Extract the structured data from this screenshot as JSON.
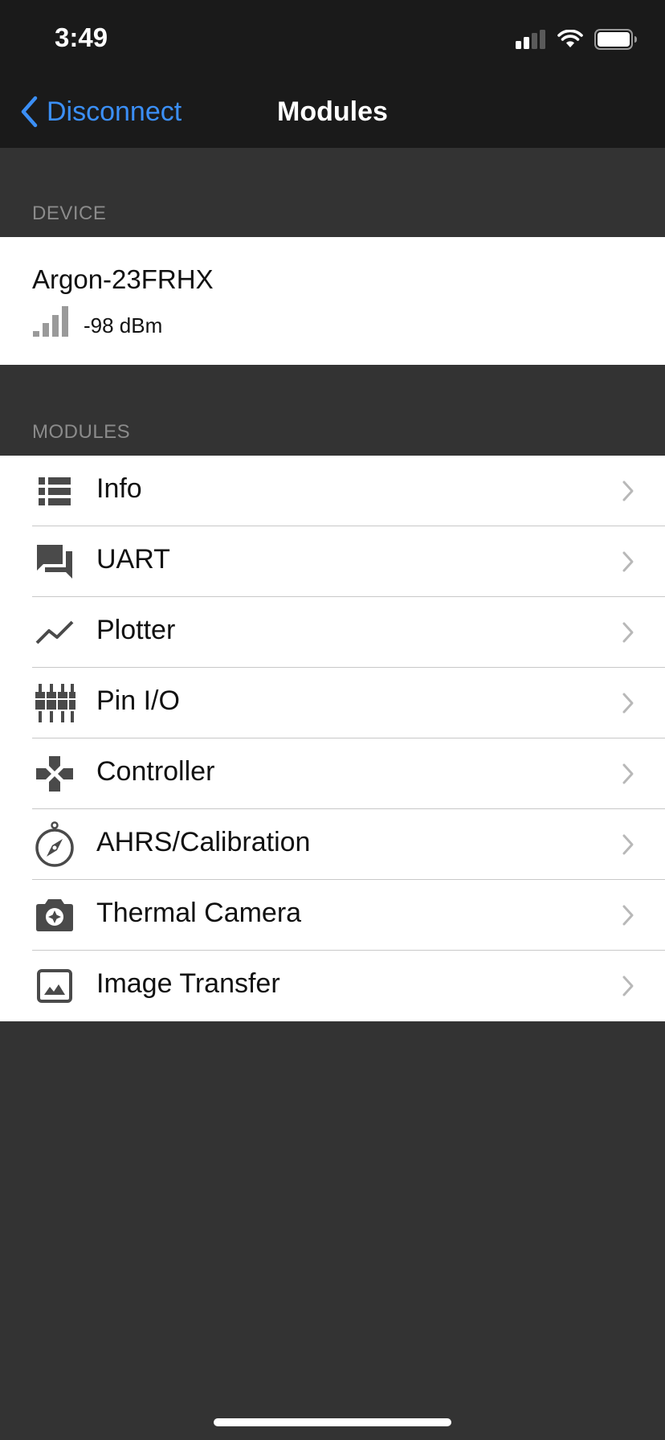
{
  "status_bar": {
    "time": "3:49",
    "signal_icon": "cellular-signal-icon",
    "wifi_icon": "wifi-icon",
    "battery_icon": "battery-icon"
  },
  "nav": {
    "back_label": "Disconnect",
    "title": "Modules",
    "accent_color": "#3b8ff6"
  },
  "device_section": {
    "header": "DEVICE",
    "name": "Argon-23FRHX",
    "rssi": "-98 dBm",
    "signal_bars_active": 0,
    "signal_bars_total": 4
  },
  "modules_section": {
    "header": "MODULES",
    "items": [
      {
        "label": "Info",
        "icon": "list-icon"
      },
      {
        "label": "UART",
        "icon": "chat-icon"
      },
      {
        "label": "Plotter",
        "icon": "line-chart-icon"
      },
      {
        "label": "Pin I/O",
        "icon": "pins-icon"
      },
      {
        "label": "Controller",
        "icon": "gamepad-icon"
      },
      {
        "label": "AHRS/Calibration",
        "icon": "compass-icon"
      },
      {
        "label": "Thermal Camera",
        "icon": "camera-icon"
      },
      {
        "label": "Image Transfer",
        "icon": "image-icon"
      }
    ]
  },
  "colors": {
    "background": "#333333",
    "bar": "#1a1a1a",
    "cell": "#ffffff",
    "icon": "#4a4a4a",
    "chevron": "#b8b8b8"
  }
}
